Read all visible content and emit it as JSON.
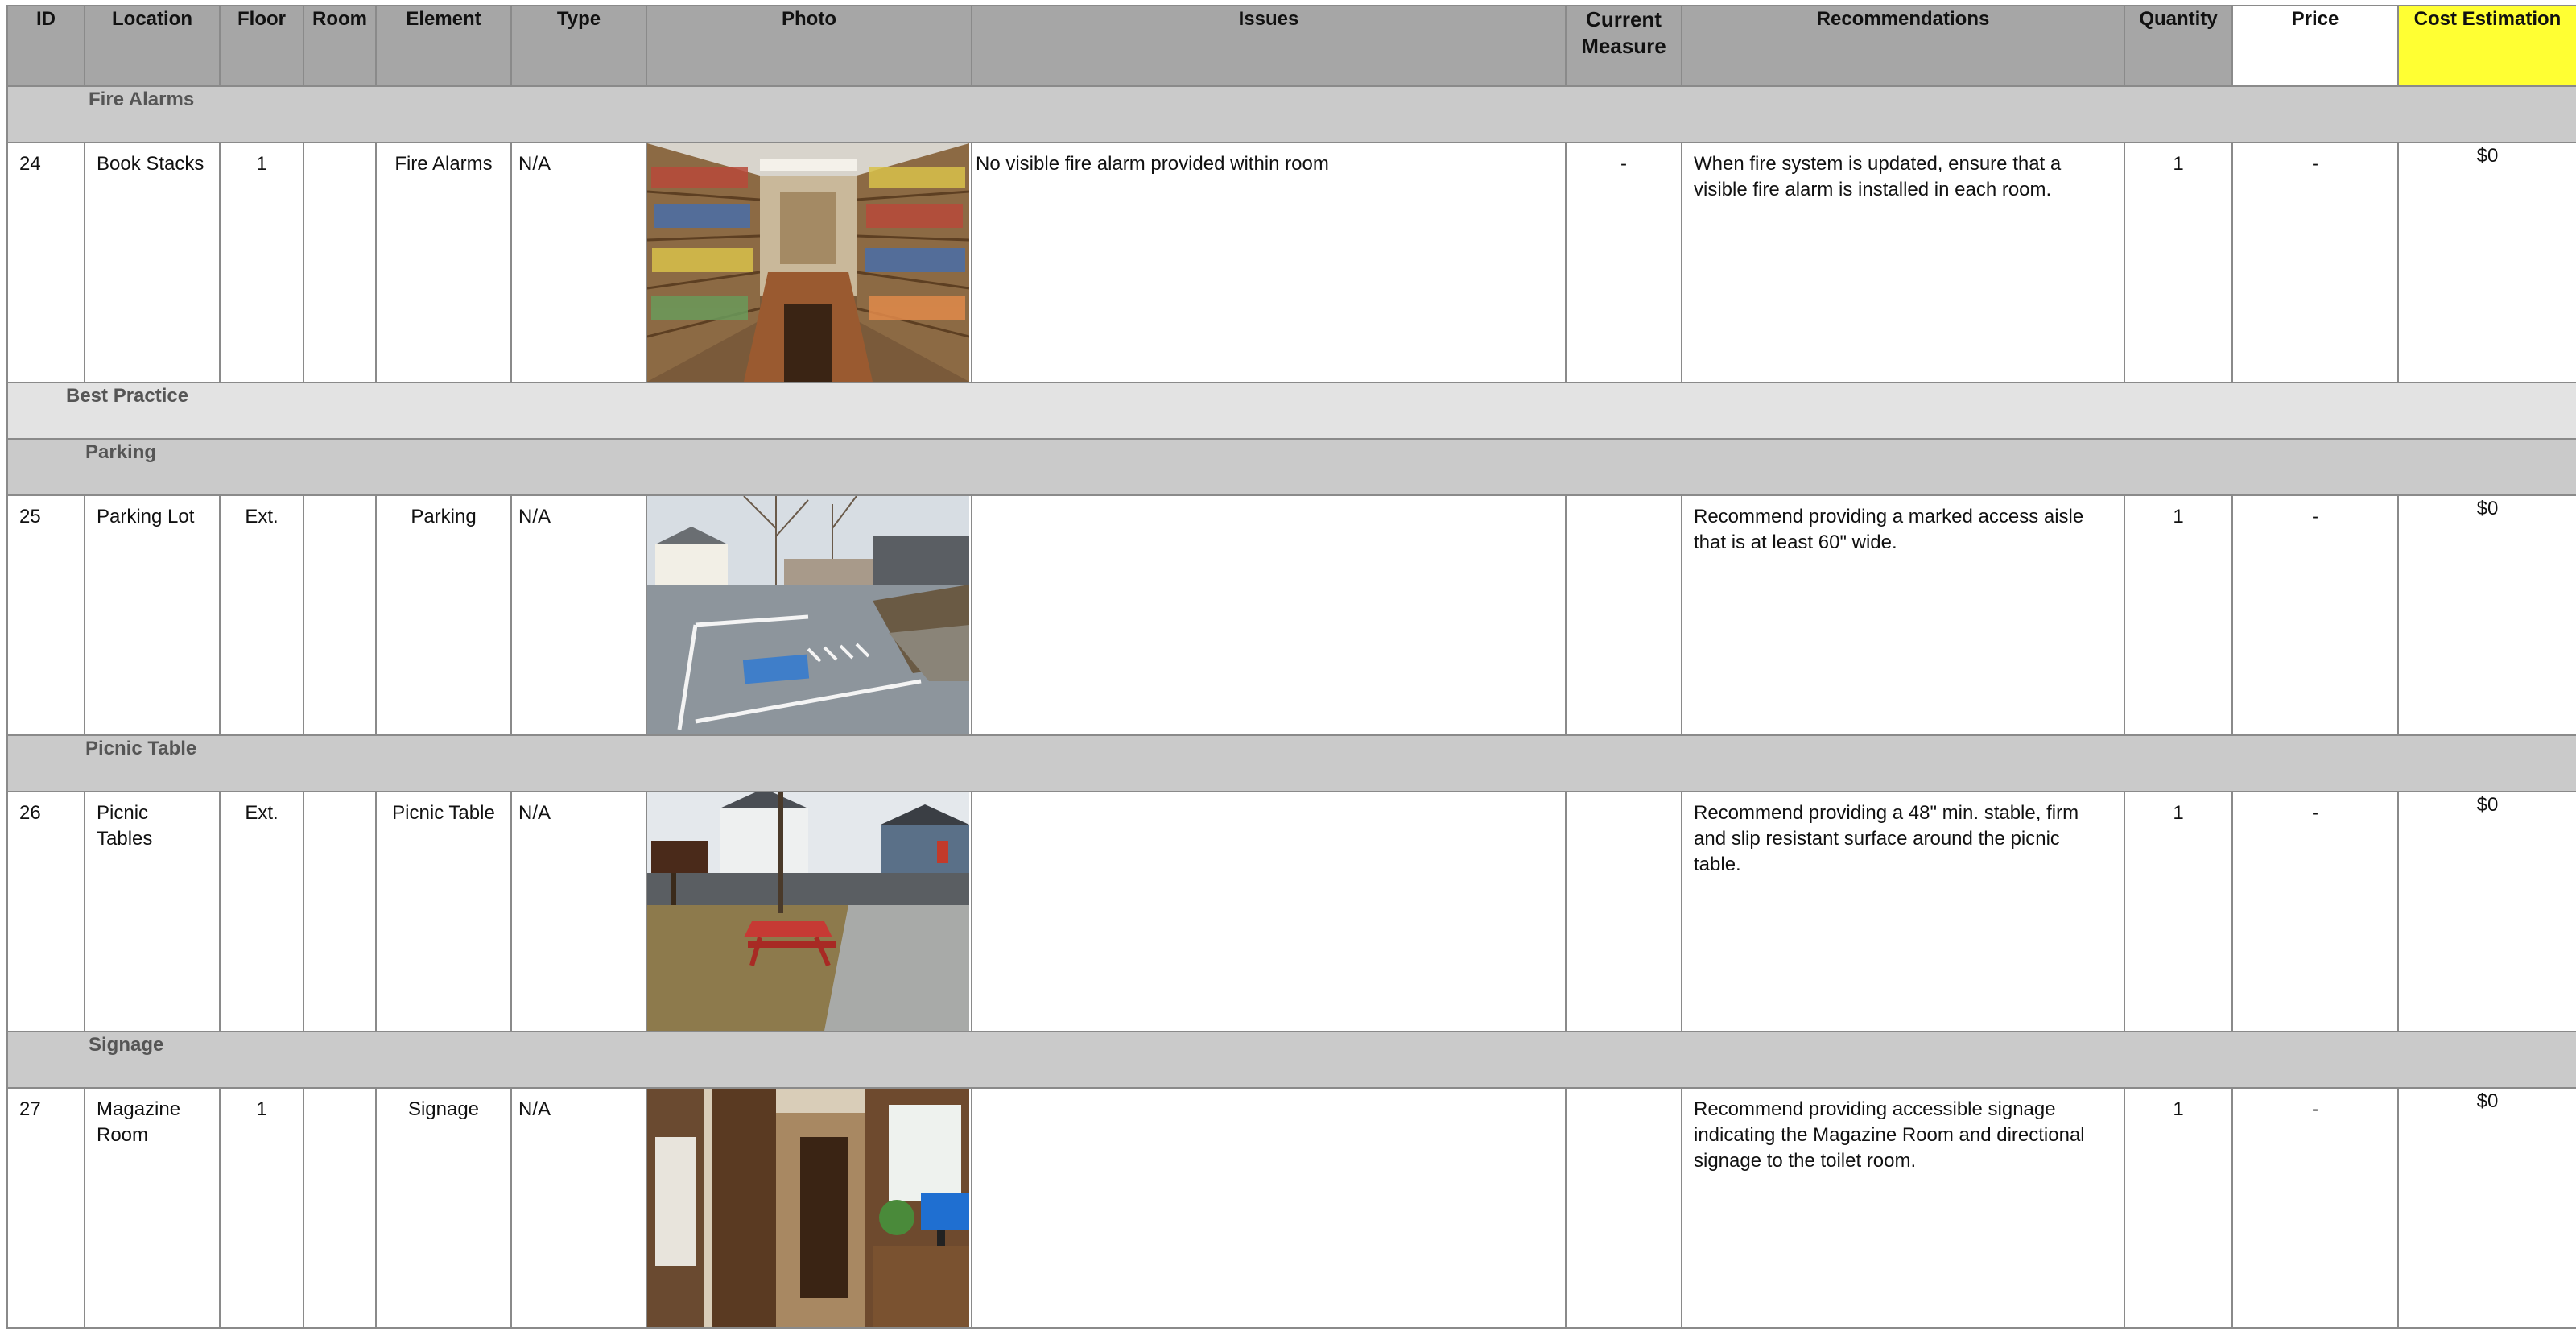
{
  "headers": {
    "id": "ID",
    "location": "Location",
    "floor": "Floor",
    "room": "Room",
    "element": "Element",
    "type": "Type",
    "photo": "Photo",
    "issues": "Issues",
    "current_measure": "Current Measure",
    "recommendations": "Recommendations",
    "quantity": "Quantity",
    "price": "Price",
    "cost_estimation": "Cost Estimation"
  },
  "sections": {
    "fire_alarms": "Fire Alarms",
    "best_practice": "Best Practice",
    "parking": "Parking",
    "picnic_table": "Picnic Table",
    "signage": "Signage"
  },
  "rows": [
    {
      "id": "24",
      "location": "Book Stacks",
      "floor": "1",
      "room": "",
      "element": "Fire Alarms",
      "type": "N/A",
      "photo": "library-book-stacks-photo",
      "issues": "No visible fire alarm provided within room",
      "current_measure": "-",
      "recommendations": "When fire system is updated, ensure that a visible fire alarm is installed in each room.",
      "quantity": "1",
      "price": "-",
      "cost": "$0"
    },
    {
      "id": "25",
      "location": "Parking Lot",
      "floor": "Ext.",
      "room": "",
      "element": "Parking",
      "type": "N/A",
      "photo": "parking-lot-photo",
      "issues": "",
      "current_measure": "",
      "recommendations": "Recommend providing a marked access aisle that is at least 60\" wide.",
      "quantity": "1",
      "price": "-",
      "cost": "$0"
    },
    {
      "id": "26",
      "location": "Picnic Tables",
      "floor": "Ext.",
      "room": "",
      "element": "Picnic Table",
      "type": "N/A",
      "photo": "picnic-table-photo",
      "issues": "",
      "current_measure": "",
      "recommendations": "Recommend providing a 48\" min. stable, firm and slip resistant surface around the picnic table.",
      "quantity": "1",
      "price": "-",
      "cost": "$0"
    },
    {
      "id": "27",
      "location": "Magazine Room",
      "floor": "1",
      "room": "",
      "element": "Signage",
      "type": "N/A",
      "photo": "magazine-room-photo",
      "issues": "",
      "current_measure": "",
      "recommendations": "Recommend providing accessible signage indicating the Magazine Room and directional signage to the toilet room.",
      "quantity": "1",
      "price": "-",
      "cost": "$0"
    }
  ],
  "colors": {
    "header": "#a6a6a6",
    "section": "#cacaca",
    "cost_header": "#ffff33"
  }
}
